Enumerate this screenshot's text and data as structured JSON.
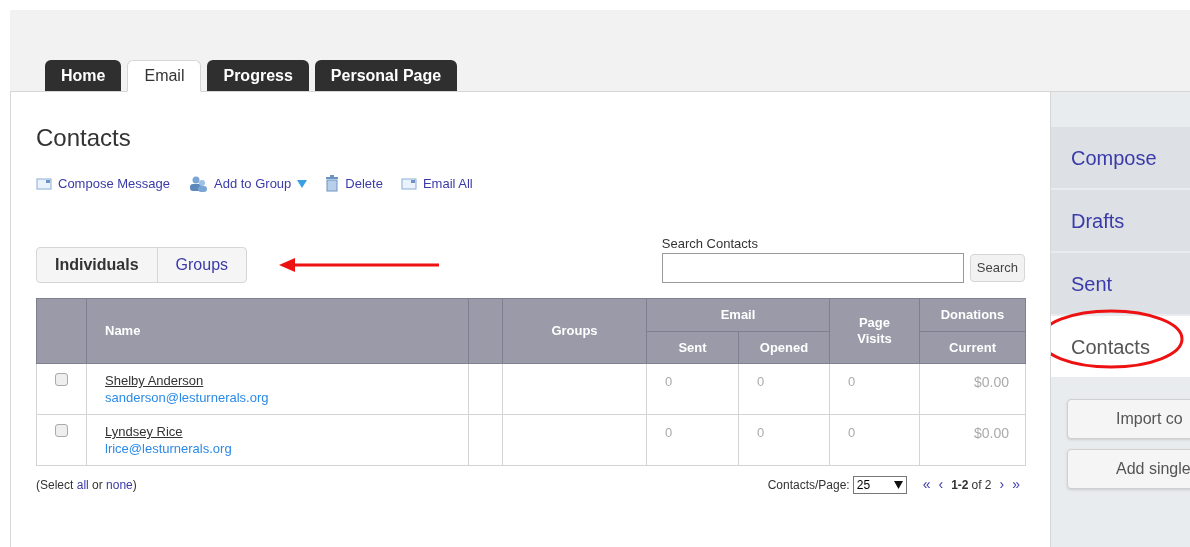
{
  "tabs": [
    {
      "label": "Home",
      "selected": false
    },
    {
      "label": "Email",
      "selected": true
    },
    {
      "label": "Progress",
      "selected": false
    },
    {
      "label": "Personal Page",
      "selected": false
    }
  ],
  "title": "Contacts",
  "actions": [
    {
      "label": "Compose Message",
      "kind": "envelope"
    },
    {
      "label": "Add to Group",
      "kind": "people",
      "dropdown": true
    },
    {
      "label": "Delete",
      "kind": "trash"
    },
    {
      "label": "Email All",
      "kind": "envelope"
    }
  ],
  "view_toggle": [
    {
      "label": "Individuals",
      "selected": true
    },
    {
      "label": "Groups",
      "selected": false
    }
  ],
  "search": {
    "label": "Search Contacts",
    "button": "Search"
  },
  "table": {
    "columns": {
      "name": "Name",
      "groups": "Groups",
      "email": "Email",
      "sent": "Sent",
      "opened": "Opened",
      "page_visits": "Page Visits",
      "donations": "Donations",
      "current": "Current"
    },
    "rows": [
      {
        "checked": false,
        "name": "Shelby Anderson",
        "email": "sanderson@lesturnerals.org",
        "sent": "0",
        "opened": "0",
        "page_visits": "0",
        "current": "$0.00"
      },
      {
        "checked": false,
        "name": "Lyndsey Rice",
        "email": "lrice@lesturnerals.org",
        "sent": "0",
        "opened": "0",
        "page_visits": "0",
        "current": "$0.00"
      }
    ]
  },
  "select_hint": {
    "before": "(Select",
    "all": "all",
    "middle": "or",
    "none": "none",
    "after": ")"
  },
  "pager": {
    "label": "Contacts/Page:",
    "per_page": "25",
    "first": "«",
    "prev": "‹",
    "range": "1-2",
    "of": "of 2",
    "next": "›",
    "last": "»"
  },
  "sidebar": {
    "items": [
      {
        "label": "Compose",
        "selected": false
      },
      {
        "label": "Drafts",
        "selected": false
      },
      {
        "label": "Sent",
        "selected": false
      },
      {
        "label": "Contacts",
        "selected": true
      }
    ],
    "buttons": [
      "Import co",
      "Add single"
    ]
  }
}
